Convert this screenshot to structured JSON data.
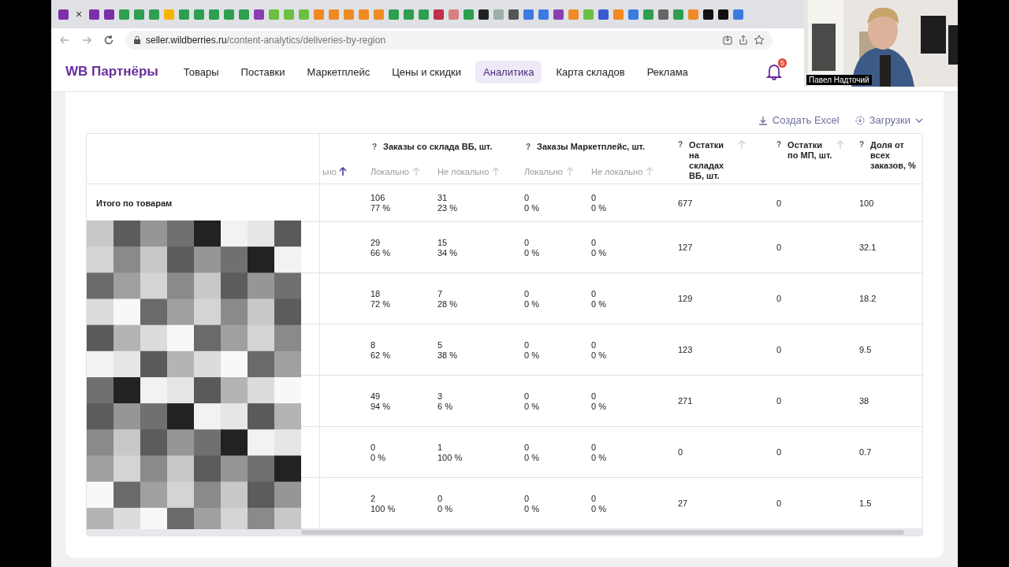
{
  "browser": {
    "tab_close": "×",
    "url_host": "seller.wildberries.ru",
    "url_path": "/content-analytics/deliveries-by-region"
  },
  "nav": {
    "logo": "WB Партнёры",
    "notifications": "5",
    "items": [
      {
        "label": "Товары",
        "selected": false
      },
      {
        "label": "Поставки",
        "selected": false
      },
      {
        "label": "Маркетплейс",
        "selected": false
      },
      {
        "label": "Цены и скидки",
        "selected": false
      },
      {
        "label": "Аналитика",
        "selected": true
      },
      {
        "label": "Карта складов",
        "selected": false
      },
      {
        "label": "Реклама",
        "selected": false
      }
    ]
  },
  "toolbar": {
    "excel": "Создать Excel",
    "downloads": "Загрузки"
  },
  "table": {
    "fragment_header": "ьно",
    "groups": [
      {
        "help": "?",
        "label": "Заказы со склада ВБ, шт.",
        "columns": [
          "Локально",
          "Не локально"
        ]
      },
      {
        "help": "?",
        "label": "Заказы Маркетплейс, шт.",
        "columns": [
          "Локально",
          "Не локально"
        ]
      }
    ],
    "singles": [
      {
        "help": "?",
        "label": "Остатки на складах ВБ, шт."
      },
      {
        "help": "?",
        "label": "Остатки по МП, шт."
      },
      {
        "help": "?",
        "label": "Доля от всех заказов, %"
      }
    ],
    "total_label": "Итого по товарам",
    "rows": [
      {
        "pairs": [
          [
            "106",
            "77 %"
          ],
          [
            "31",
            "23 %"
          ],
          [
            "0",
            "0 %"
          ],
          [
            "0",
            "0 %"
          ]
        ],
        "values": [
          "677",
          "0",
          "100"
        ]
      },
      {
        "pairs": [
          [
            "29",
            "66 %"
          ],
          [
            "15",
            "34 %"
          ],
          [
            "0",
            "0 %"
          ],
          [
            "0",
            "0 %"
          ]
        ],
        "values": [
          "127",
          "0",
          "32.1"
        ]
      },
      {
        "pairs": [
          [
            "18",
            "72 %"
          ],
          [
            "7",
            "28 %"
          ],
          [
            "0",
            "0 %"
          ],
          [
            "0",
            "0 %"
          ]
        ],
        "values": [
          "129",
          "0",
          "18.2"
        ]
      },
      {
        "pairs": [
          [
            "8",
            "62 %"
          ],
          [
            "5",
            "38 %"
          ],
          [
            "0",
            "0 %"
          ],
          [
            "0",
            "0 %"
          ]
        ],
        "values": [
          "123",
          "0",
          "9.5"
        ]
      },
      {
        "pairs": [
          [
            "49",
            "94 %"
          ],
          [
            "3",
            "6 %"
          ],
          [
            "0",
            "0 %"
          ],
          [
            "0",
            "0 %"
          ]
        ],
        "values": [
          "271",
          "0",
          "38"
        ]
      },
      {
        "pairs": [
          [
            "0",
            "0 %"
          ],
          [
            "1",
            "100 %"
          ],
          [
            "0",
            "0 %"
          ],
          [
            "0",
            "0 %"
          ]
        ],
        "values": [
          "0",
          "0",
          "0.7"
        ]
      },
      {
        "pairs": [
          [
            "2",
            "100 %"
          ],
          [
            "0",
            "0 %"
          ],
          [
            "0",
            "0 %"
          ],
          [
            "0",
            "0 %"
          ]
        ],
        "values": [
          "27",
          "0",
          "1.5"
        ]
      }
    ]
  },
  "webcam": {
    "name": "Павел Надточий"
  }
}
